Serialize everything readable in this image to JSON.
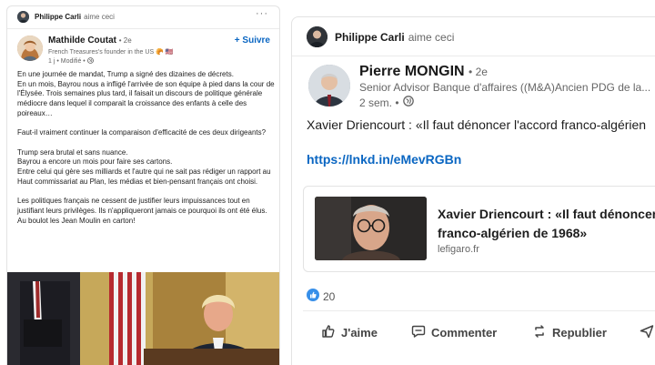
{
  "left_post": {
    "context": {
      "name": "Philippe Carli",
      "action": "aime ceci"
    },
    "more_icon": "ellipsis-icon",
    "author": {
      "name": "Mathilde Coutat",
      "degree": "• 2e",
      "subtitle": "French Treasures's founder in the US 🥐 🇺🇸",
      "time": "1 j •",
      "edited": "Modifié •"
    },
    "follow_label": "+ Suivre",
    "body": [
      "En une journée de mandat, Trump a signé des dizaines de décrets.",
      "En un mois, Bayrou nous a infligé l'arrivée de son équipe à pied dans la cour de l'Élysée. Trois semaines plus tard, il faisait un discours de politique générale médiocre dans lequel il comparait la croissance des enfants à celle des poireaux…",
      "",
      "Faut-il vraiment continuer la comparaison d'efficacité de ces deux dirigeants?",
      "",
      "Trump sera brutal et sans nuance.",
      "Bayrou a encore un mois pour faire ses cartons.",
      "Entre celui qui gère ses milliards et l'autre qui ne sait pas rédiger un rapport au Haut commissariat au Plan, les médias et bien-pensant français ont choisi.",
      "",
      "Les politiques français ne cessent de justifier leurs impuissances tout en justifiant leurs privilèges. Ils n'appliqueront jamais ce pourquoi ils ont été élus.",
      "Au boulot les Jean Moulin en carton!"
    ]
  },
  "right_post": {
    "context": {
      "name": "Philippe Carli",
      "action": "aime ceci"
    },
    "author": {
      "name": "Pierre MONGIN",
      "degree": "• 2e",
      "subtitle": "Senior Advisor Banque d'affaires ((M&A)Ancien PDG de la...",
      "time": "2 sem. •"
    },
    "text": "Xavier Driencourt : «Il faut dénoncer l'accord franco-algérien",
    "link": "https://lnkd.in/eMevRGBn",
    "card": {
      "title_line1": "Xavier Driencourt : «Il faut dénoncer",
      "title_line2": "franco-algérien de 1968»",
      "source": "lefigaro.fr"
    },
    "reactions": {
      "count": "20",
      "icon": "like-reaction-icon"
    },
    "actions": [
      {
        "label": "J'aime",
        "icon": "thumbs-up-icon"
      },
      {
        "label": "Commenter",
        "icon": "comment-icon"
      },
      {
        "label": "Republier",
        "icon": "repost-icon"
      }
    ]
  },
  "colors": {
    "link": "#0a66c2",
    "muted": "#666666",
    "border": "#e3e3e3"
  }
}
